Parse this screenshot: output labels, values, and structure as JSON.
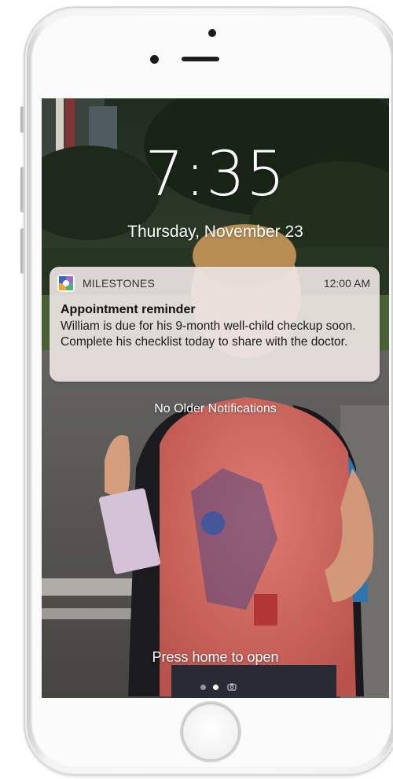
{
  "lock_screen": {
    "time": "7:35",
    "date": "Thursday, November 23",
    "no_older_notifications": "No Older Notifications",
    "press_home": "Press home to open"
  },
  "notification": {
    "app_name": "MILESTONES",
    "time": "12:00 AM",
    "title": "Appointment reminder",
    "body": "William is due for his 9-month well-child checkup soon. Complete his checklist today to share with the doctor."
  },
  "page_indicator": {
    "pages": 2,
    "active_page": 2,
    "trailing_icon": "camera-icon"
  },
  "colors": {
    "notification_bg": "#ece4e2",
    "text_white": "#ffffff",
    "app_icon_blue": "#3b64c8",
    "app_icon_orange": "#f2a23a"
  }
}
